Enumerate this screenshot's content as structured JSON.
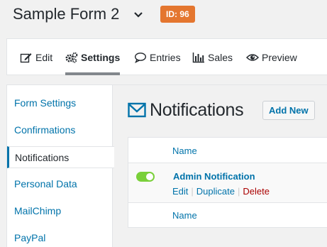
{
  "header": {
    "form_title": "Sample Form 2",
    "id_badge": "ID: 96"
  },
  "tabs": [
    {
      "label": "Edit",
      "icon": "edit-icon"
    },
    {
      "label": "Settings",
      "icon": "gears-icon",
      "active": true
    },
    {
      "label": "Entries",
      "icon": "speech-bubble-icon"
    },
    {
      "label": "Sales",
      "icon": "bar-chart-icon"
    },
    {
      "label": "Preview",
      "icon": "eye-icon"
    }
  ],
  "sidebar": {
    "items": [
      {
        "label": "Form Settings"
      },
      {
        "label": "Confirmations"
      },
      {
        "label": "Notifications",
        "active": true
      },
      {
        "label": "Personal Data"
      },
      {
        "label": "MailChimp"
      },
      {
        "label": "PayPal"
      }
    ]
  },
  "main": {
    "title": "Notifications",
    "add_new": "Add New",
    "table": {
      "header": "Name",
      "footer": "Name",
      "rows": [
        {
          "name": "Admin Notification",
          "active": true,
          "actions": {
            "edit": "Edit",
            "duplicate": "Duplicate",
            "delete": "Delete"
          }
        }
      ]
    }
  },
  "colors": {
    "accent": "#0073aa",
    "badge": "#e4762f",
    "toggle_on": "#7ad03a",
    "delete": "#aa0000"
  }
}
